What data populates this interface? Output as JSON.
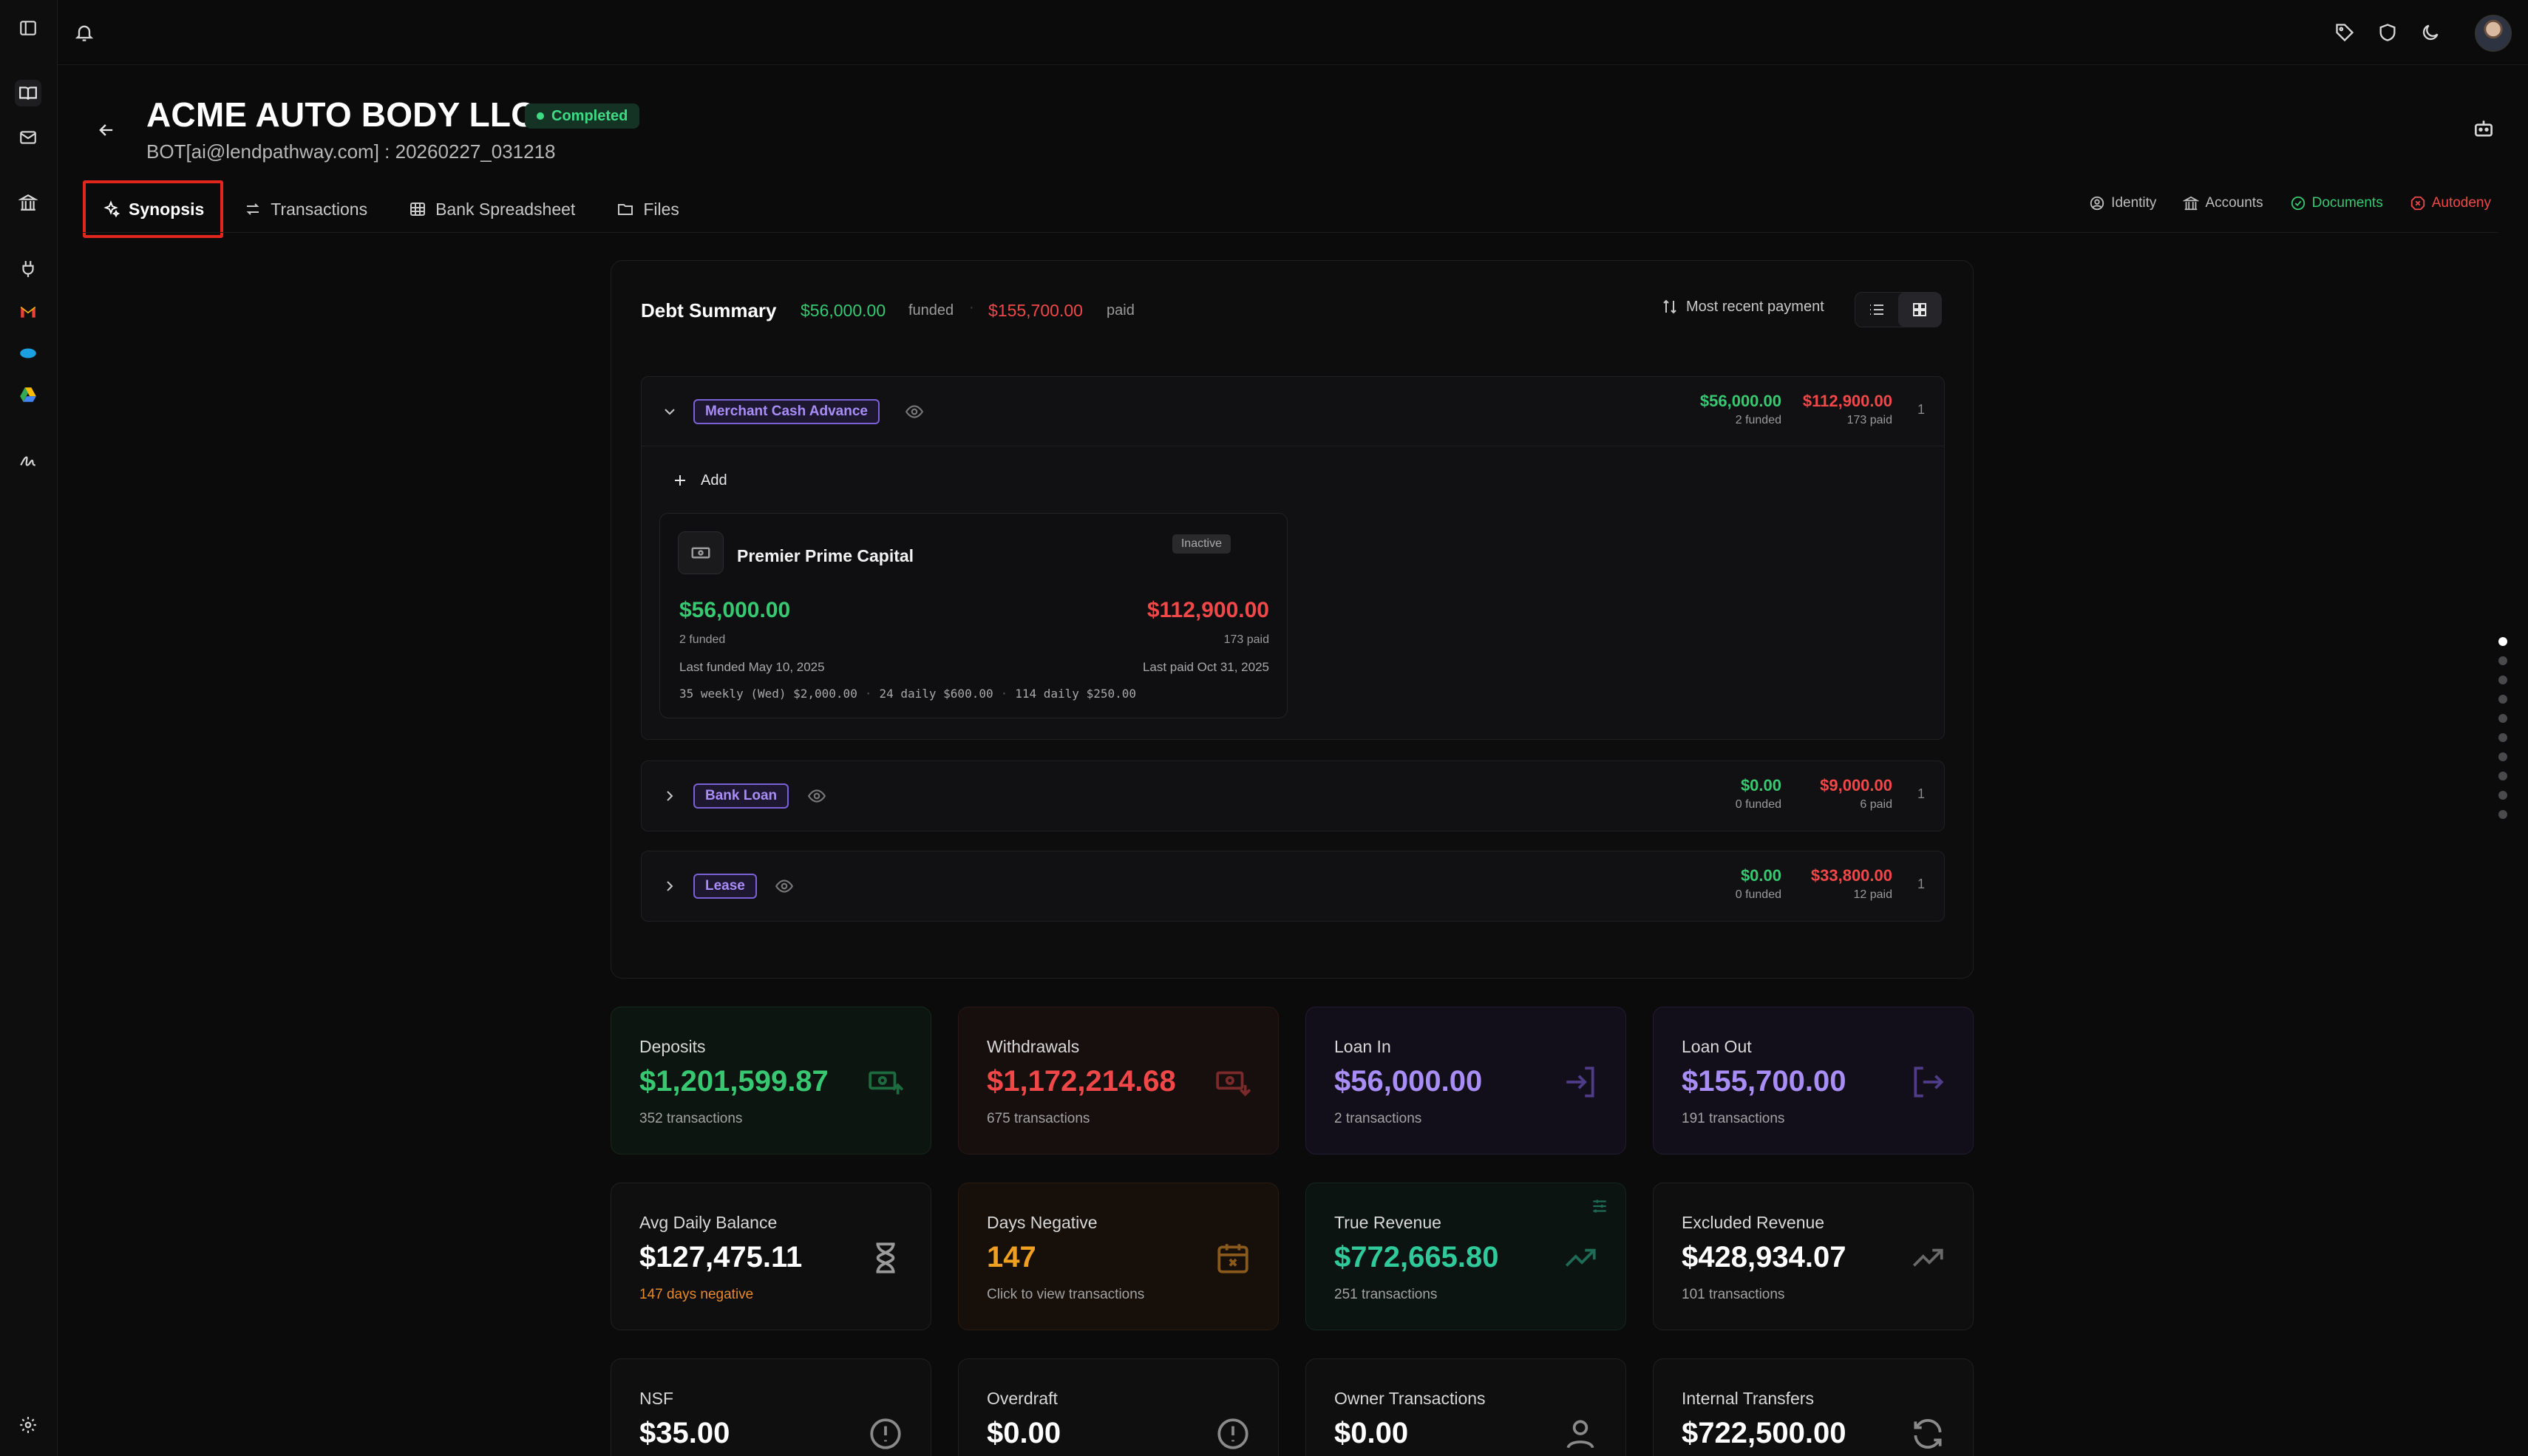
{
  "header": {
    "title": "ACME AUTO BODY LLC",
    "status": "Completed",
    "subtitle": "BOT[ai@lendpathway.com] : 20260227_031218"
  },
  "tabs": [
    {
      "label": "Synopsis",
      "icon": "sparkles-icon",
      "selected": true
    },
    {
      "label": "Transactions",
      "icon": "arrows-swap-icon"
    },
    {
      "label": "Bank Spreadsheet",
      "icon": "table-icon"
    },
    {
      "label": "Files",
      "icon": "folder-icon"
    }
  ],
  "right_tabs": {
    "identity": "Identity",
    "accounts": "Accounts",
    "documents": "Documents",
    "autodeny": "Autodeny"
  },
  "debt_summary": {
    "title": "Debt Summary",
    "funded": "$56,000.00",
    "funded_label": "funded",
    "separator": "·",
    "paid": "$155,700.00",
    "paid_label": "paid",
    "sort_label": "Most recent payment",
    "groups": [
      {
        "label": "Merchant Cash Advance",
        "expanded": true,
        "funded": "$56,000.00",
        "funded_sub": "2 funded",
        "paid": "$112,900.00",
        "paid_sub": "173 paid",
        "count": "1",
        "add_label": "Add",
        "lender": {
          "name": "Premier Prime Capital",
          "status": "Inactive",
          "funded": "$56,000.00",
          "funded_sub": "2 funded",
          "paid": "$112,900.00",
          "paid_sub": "173 paid",
          "last_funded": "Last funded May 10, 2025",
          "last_paid": "Last paid Oct 31, 2025",
          "terms": [
            "35 weekly (Wed) $2,000.00",
            "24 daily $600.00",
            "114 daily $250.00"
          ]
        }
      },
      {
        "label": "Bank Loan",
        "expanded": false,
        "funded": "$0.00",
        "funded_sub": "0 funded",
        "paid": "$9,000.00",
        "paid_sub": "6 paid",
        "count": "1"
      },
      {
        "label": "Lease",
        "expanded": false,
        "funded": "$0.00",
        "funded_sub": "0 funded",
        "paid": "$33,800.00",
        "paid_sub": "12 paid",
        "count": "1"
      }
    ]
  },
  "metrics": [
    {
      "label": "Deposits",
      "value": "$1,201,599.87",
      "sub": "352 transactions",
      "icon": "cash-in-icon",
      "tone": "green"
    },
    {
      "label": "Withdrawals",
      "value": "$1,172,214.68",
      "sub": "675 transactions",
      "icon": "cash-out-icon",
      "tone": "red"
    },
    {
      "label": "Loan In",
      "value": "$56,000.00",
      "sub": "2 transactions",
      "icon": "login-icon",
      "tone": "purple"
    },
    {
      "label": "Loan Out",
      "value": "$155,700.00",
      "sub": "191 transactions",
      "icon": "logout-icon",
      "tone": "purple"
    },
    {
      "label": "Avg Daily Balance",
      "value": "$127,475.11",
      "sub": "147 days negative",
      "icon": "hourglass-icon",
      "tone": "neutral"
    },
    {
      "label": "Days Negative",
      "value": "147",
      "sub": "Click to view transactions",
      "icon": "calendar-x-icon",
      "tone": "orange"
    },
    {
      "label": "True Revenue",
      "value": "$772,665.80",
      "sub": "251 transactions",
      "icon": "trending-up-icon",
      "tone": "teal"
    },
    {
      "label": "Excluded Revenue",
      "value": "$428,934.07",
      "sub": "101 transactions",
      "icon": "trending-up-icon",
      "tone": "neutral"
    },
    {
      "label": "NSF",
      "value": "$35.00",
      "icon": "alert-circle-icon",
      "tone": "neutral"
    },
    {
      "label": "Overdraft",
      "value": "$0.00",
      "icon": "alert-circle-icon",
      "tone": "neutral"
    },
    {
      "label": "Owner Transactions",
      "value": "$0.00",
      "icon": "user-icon",
      "tone": "neutral"
    },
    {
      "label": "Internal Transfers",
      "value": "$722,500.00",
      "icon": "refresh-icon",
      "tone": "neutral"
    }
  ],
  "colors": {
    "funded": "#37c871",
    "paid": "#f04848",
    "pill": "#a88df7",
    "highlight": "#e0261d",
    "documents": "#37c871",
    "autodeny": "#f04848"
  }
}
